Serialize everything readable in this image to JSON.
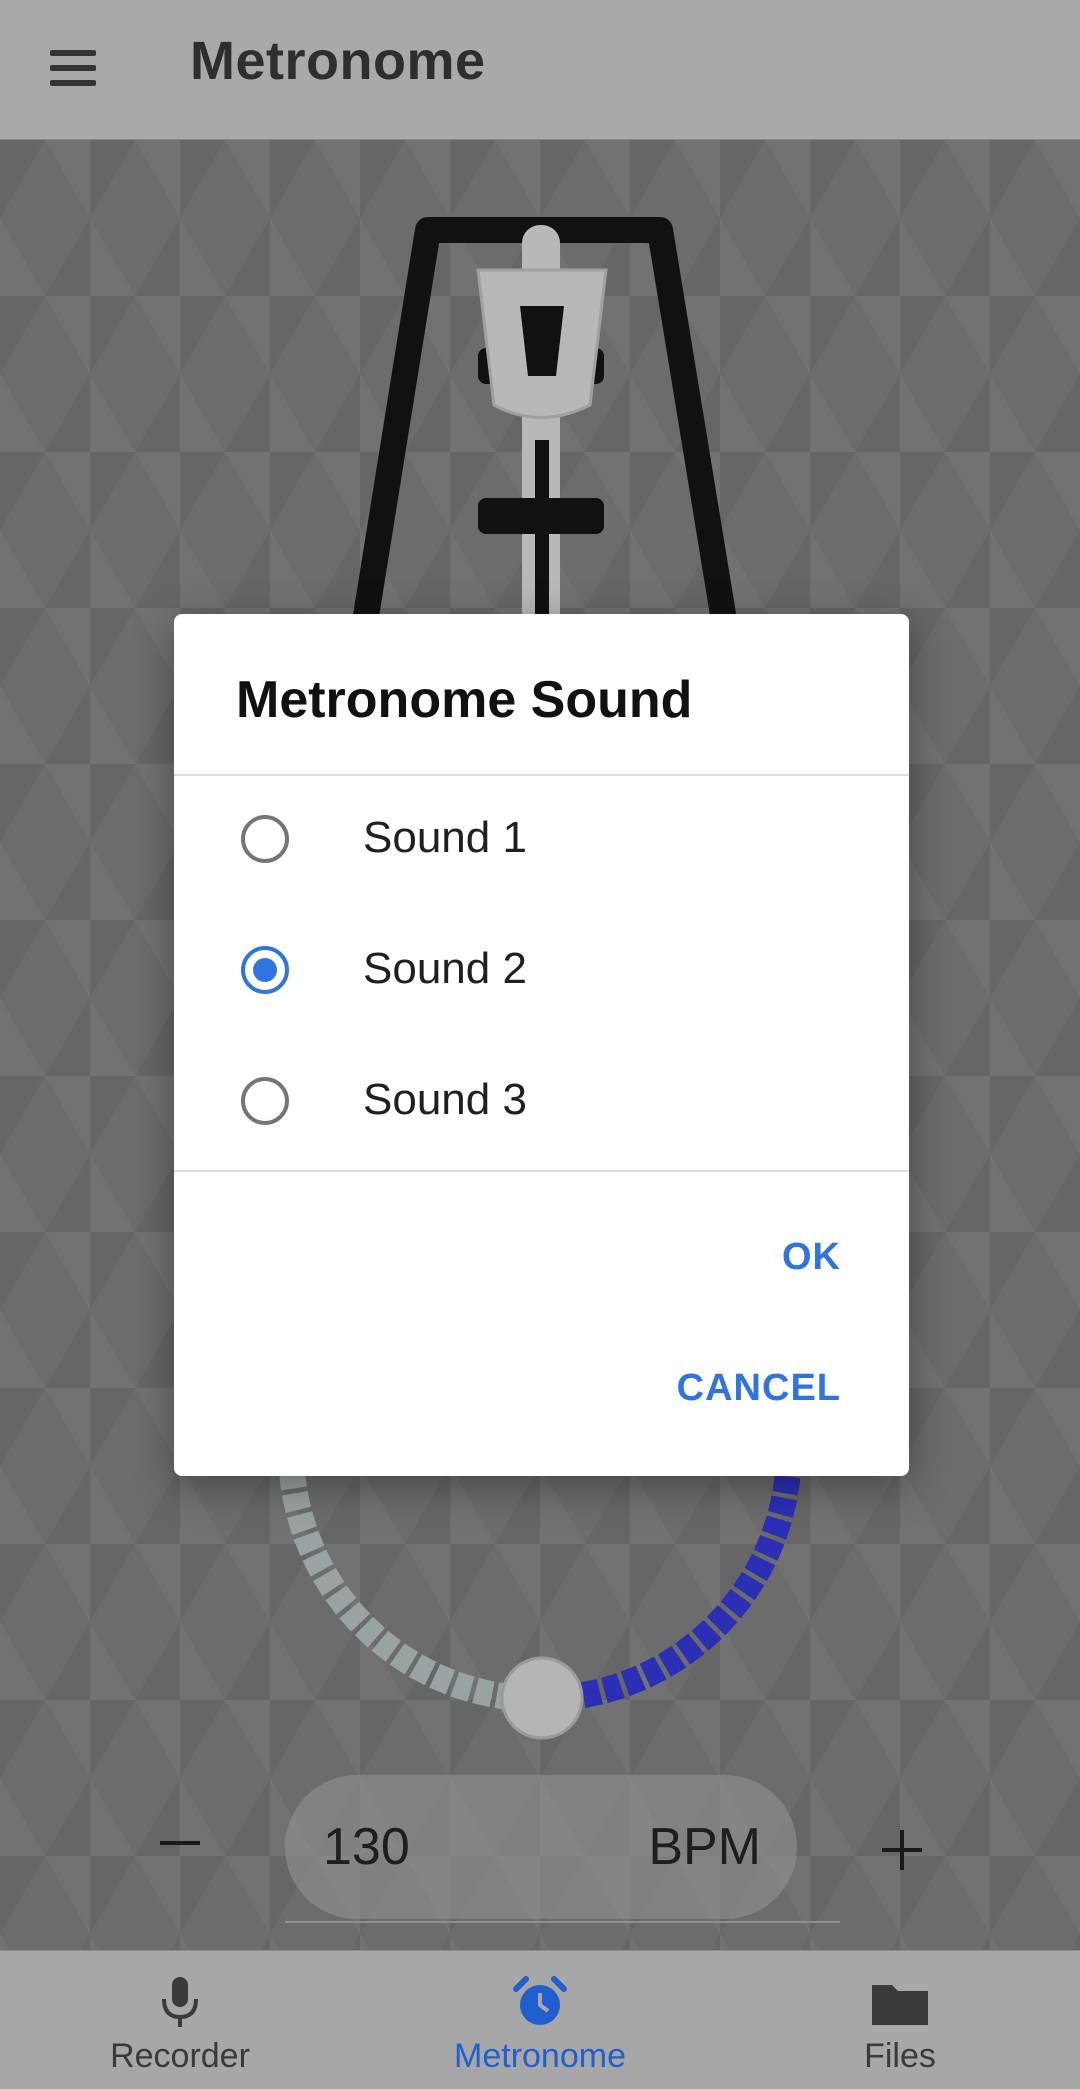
{
  "appbar": {
    "title": "Metronome",
    "menu_icon": "hamburger-menu-icon"
  },
  "bpm": {
    "value": "130",
    "unit": "BPM",
    "minus_icon": "minus-icon",
    "plus_icon": "plus-icon"
  },
  "tempo_dial": {
    "progress_fraction": 0.5,
    "filled_color": "#2b2fb5",
    "empty_color": "#9aa3a3"
  },
  "dialog": {
    "title": "Metronome Sound",
    "options": [
      {
        "label": "Sound 1",
        "selected": false
      },
      {
        "label": "Sound 2",
        "selected": true
      },
      {
        "label": "Sound 3",
        "selected": false
      }
    ],
    "ok_label": "OK",
    "cancel_label": "CANCEL"
  },
  "bottom_nav": {
    "items": [
      {
        "label": "Recorder",
        "icon": "microphone-icon",
        "active": false
      },
      {
        "label": "Metronome",
        "icon": "alarm-clock-icon",
        "active": true
      },
      {
        "label": "Files",
        "icon": "folder-icon",
        "active": false
      }
    ]
  },
  "colors": {
    "accent": "#2f74e0",
    "appbar": "#a9a9a9",
    "nav_active": "#1f5fcf"
  }
}
